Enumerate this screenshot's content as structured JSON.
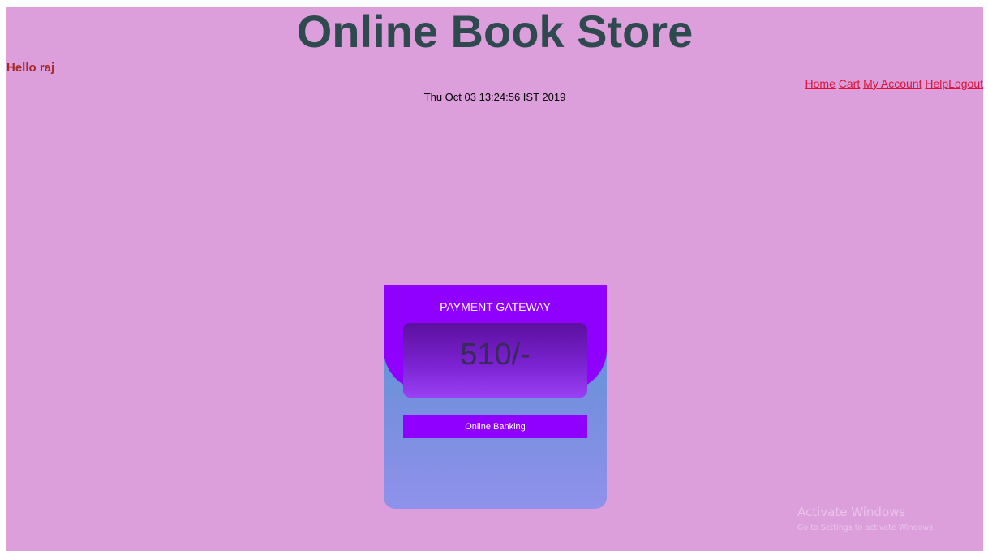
{
  "header": {
    "title": "Online Book Store",
    "greeting": "Hello raj",
    "datetime": "Thu Oct 03 13:24:56 IST 2019"
  },
  "nav": {
    "home": "Home",
    "cart": "Cart",
    "my_account": "My Account",
    "help": "Help",
    "logout": "Logout"
  },
  "payment": {
    "title": "PAYMENT GATEWAY",
    "amount": "510/-",
    "button_label": "Online Banking"
  },
  "watermark": {
    "title": "Activate Windows",
    "subtitle": "Go to Settings to activate Windows."
  },
  "colors": {
    "page_background": "#dc9fdc",
    "title": "#2f4a4f",
    "greeting": "#a52a2a",
    "nav_link": "#dc143c",
    "accent_purple": "#8f00ff"
  }
}
